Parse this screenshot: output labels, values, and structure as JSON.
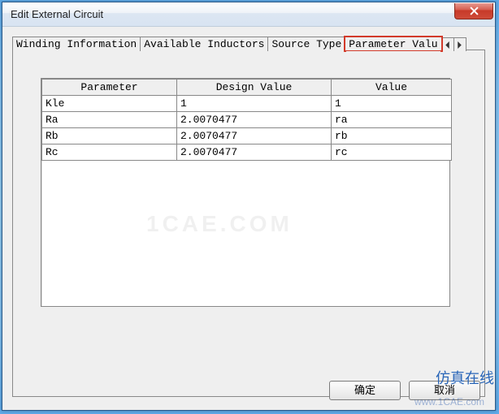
{
  "window": {
    "title": "Edit External Circuit"
  },
  "tabs": {
    "items": [
      {
        "label": "Winding Information"
      },
      {
        "label": "Available Inductors"
      },
      {
        "label": "Source Type"
      },
      {
        "label": "Parameter Valu"
      }
    ],
    "active_index": 3
  },
  "table": {
    "headers": {
      "parameter": "Parameter",
      "design_value": "Design Value",
      "value": "Value"
    },
    "rows": [
      {
        "parameter": "Kle",
        "design_value": "1",
        "value": "1"
      },
      {
        "parameter": "Ra",
        "design_value": "2.0070477",
        "value": "ra"
      },
      {
        "parameter": "Rb",
        "design_value": "2.0070477",
        "value": "rb"
      },
      {
        "parameter": "Rc",
        "design_value": "2.0070477",
        "value": "rc"
      }
    ]
  },
  "buttons": {
    "ok": "确定",
    "cancel": "取消"
  },
  "watermarks": {
    "center": "1CAE.COM",
    "side": "仿真在线",
    "url": "www.1CAE.com"
  }
}
